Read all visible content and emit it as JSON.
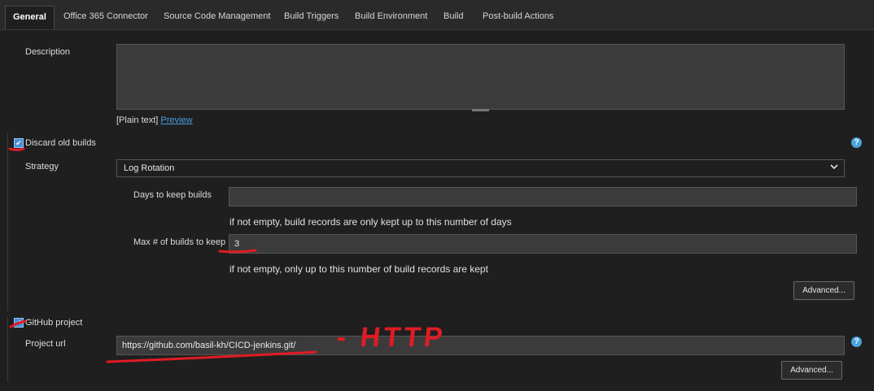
{
  "tabs": [
    {
      "label": "General"
    },
    {
      "label": "Office 365 Connector"
    },
    {
      "label": "Source Code Management"
    },
    {
      "label": "Build Triggers"
    },
    {
      "label": "Build Environment"
    },
    {
      "label": "Build"
    },
    {
      "label": "Post-build Actions"
    }
  ],
  "description": {
    "label": "Description",
    "value": "",
    "plain_text": "[Plain text]",
    "preview": "Preview"
  },
  "discard": {
    "label": "Discard old builds",
    "checked": true,
    "strategy_label": "Strategy",
    "strategy_value": "Log Rotation",
    "days_label": "Days to keep builds",
    "days_value": "",
    "days_help": "if not empty, build records are only kept up to this number of days",
    "max_label": "Max # of builds to keep",
    "max_value": "3",
    "max_help": "if not empty, only up to this number of build records are kept",
    "advanced": "Advanced..."
  },
  "github": {
    "label": "GitHub project",
    "checked": true,
    "url_label": "Project url",
    "url_value": "https://github.com/basil-kh/CICD-jenkins.git/",
    "advanced": "Advanced..."
  },
  "annotation": {
    "text": "- HTTP",
    "color": "#e01b24"
  },
  "help_glyph": "?",
  "check_glyph": "✔",
  "chevron_glyph": "⌄"
}
